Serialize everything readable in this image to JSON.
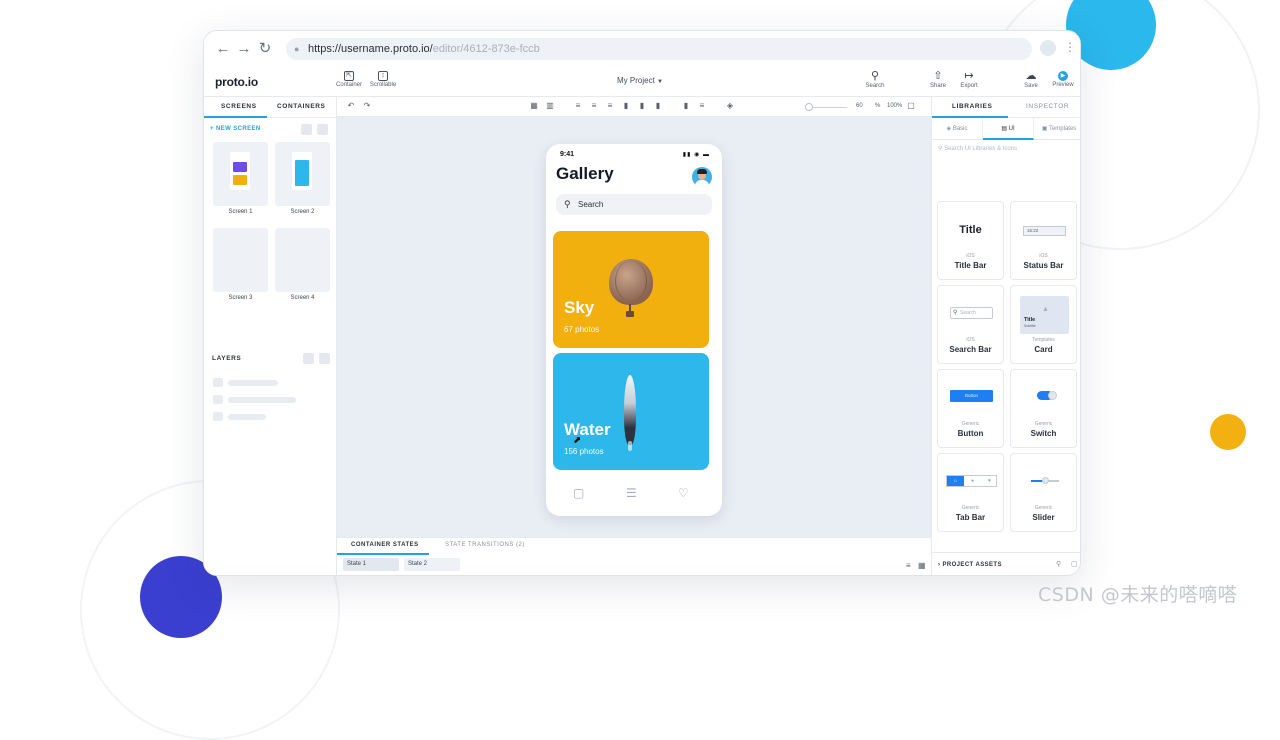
{
  "browser": {
    "url_main": "https://username.proto.io/",
    "url_path": "editor/4612-873e-fccb"
  },
  "app": {
    "logo": "proto.io",
    "project_title": "My Project",
    "tools_left": [
      {
        "label": "Container",
        "icon": "container-icon"
      },
      {
        "label": "Scrollable",
        "icon": "scrollable-icon"
      }
    ],
    "tools_right": [
      {
        "label": "Search",
        "icon": "search-icon"
      },
      {
        "label": "Share",
        "icon": "share-icon"
      },
      {
        "label": "Export",
        "icon": "export-icon"
      },
      {
        "label": "Save",
        "icon": "save-icon"
      },
      {
        "label": "Preview",
        "icon": "play-icon"
      }
    ]
  },
  "left_panel": {
    "tabs": [
      "SCREENS",
      "CONTAINERS"
    ],
    "new_screen": "+ NEW SCREEN",
    "screens": [
      "Screen 1",
      "Screen 2",
      "Screen 3",
      "Screen 4"
    ],
    "layers_title": "LAYERS"
  },
  "canvas_toolbar": {
    "zoom_value": "60",
    "zoom_unit": "%",
    "zoom_fit": "100%"
  },
  "phone": {
    "time": "9:41",
    "title": "Gallery",
    "search_placeholder": "Search",
    "cards": [
      {
        "title": "Sky",
        "subtitle": "67 photos",
        "color": "#f2b00f"
      },
      {
        "title": "Water",
        "subtitle": "156 photos",
        "color": "#2db7ea"
      }
    ]
  },
  "states": {
    "tabs": [
      "CONTAINER STATES",
      "STATE TRANSITIONS (2)"
    ],
    "chips": [
      "State 1",
      "State 2"
    ]
  },
  "right_panel": {
    "tabs": [
      "LIBRARIES",
      "INSPECTOR"
    ],
    "subtabs": [
      "Basic",
      "UI",
      "Templates"
    ],
    "search_placeholder": "Search UI Libraries & Icons",
    "components": [
      {
        "category": "iOS",
        "name": "Title Bar",
        "preview": "Title"
      },
      {
        "category": "iOS",
        "name": "Status Bar",
        "preview": "16:22"
      },
      {
        "category": "iOS",
        "name": "Search Bar",
        "preview": "Search"
      },
      {
        "category": "Templates",
        "name": "Card",
        "preview": "Title",
        "preview_sub": "Subtitle"
      },
      {
        "category": "Generic",
        "name": "Button",
        "preview": "Button"
      },
      {
        "category": "Generic",
        "name": "Switch"
      },
      {
        "category": "Generic",
        "name": "Tab Bar"
      },
      {
        "category": "Generic",
        "name": "Slider"
      }
    ],
    "project_assets": "PROJECT ASSETS"
  },
  "watermark": "CSDN @未来的嗒嘀嗒",
  "colors": {
    "accent": "#1fa3e6",
    "sky_card": "#f2b00f",
    "water_card": "#2db7ea",
    "ios_blue": "#1f7ff0"
  }
}
